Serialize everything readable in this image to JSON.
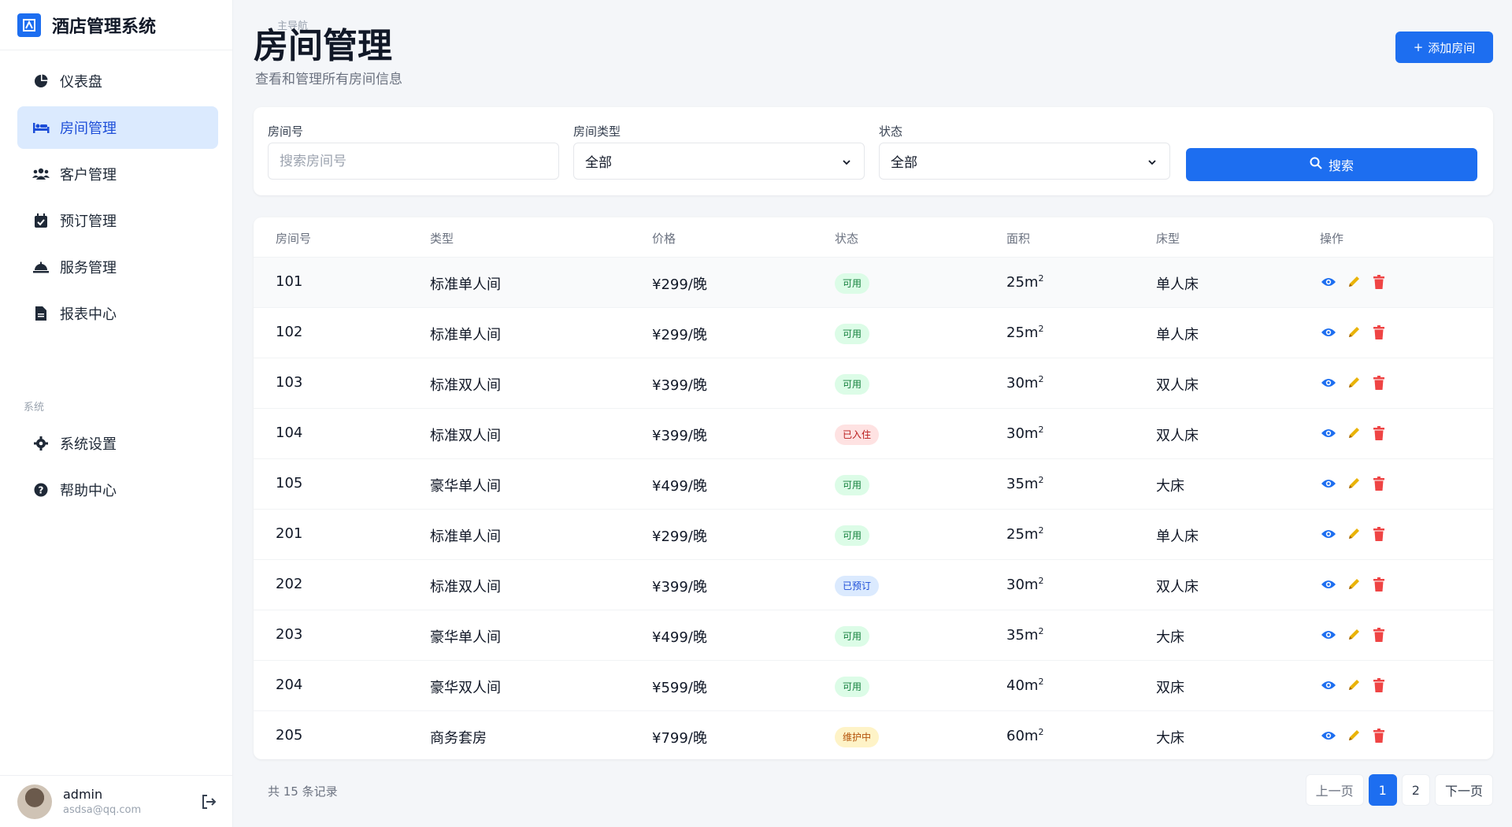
{
  "app": {
    "title": "酒店管理系统",
    "accent": "#1d6ef0"
  },
  "sidebar": {
    "section_main": "主导航",
    "section_system": "系统",
    "items": [
      {
        "label": "仪表盘",
        "icon": "chart-pie-icon"
      },
      {
        "label": "房间管理",
        "icon": "bed-icon",
        "active": true
      },
      {
        "label": "客户管理",
        "icon": "users-icon"
      },
      {
        "label": "预订管理",
        "icon": "calendar-check-icon"
      },
      {
        "label": "服务管理",
        "icon": "bell-concierge-icon"
      },
      {
        "label": "报表中心",
        "icon": "file-icon"
      }
    ],
    "system_items": [
      {
        "label": "系统设置",
        "icon": "gear-icon"
      },
      {
        "label": "帮助中心",
        "icon": "question-circle-icon"
      }
    ],
    "user": {
      "name": "admin",
      "email": "asdsa@qq.com"
    }
  },
  "header": {
    "title": "房间管理",
    "subtitle": "查看和管理所有房间信息",
    "add_button": "添加房间"
  },
  "filters": {
    "room_no_label": "房间号",
    "room_no_placeholder": "搜索房间号",
    "room_type_label": "房间类型",
    "room_type_value": "全部",
    "status_label": "状态",
    "status_value": "全部",
    "search_button": "搜索"
  },
  "table": {
    "columns": [
      "房间号",
      "类型",
      "价格",
      "状态",
      "面积",
      "床型",
      "操作"
    ],
    "rows": [
      {
        "no": "101",
        "type": "标准单人间",
        "price": "¥299/晚",
        "status": "可用",
        "status_color": "green",
        "area": "25m",
        "bed": "单人床"
      },
      {
        "no": "102",
        "type": "标准单人间",
        "price": "¥299/晚",
        "status": "可用",
        "status_color": "green",
        "area": "25m",
        "bed": "单人床"
      },
      {
        "no": "103",
        "type": "标准双人间",
        "price": "¥399/晚",
        "status": "可用",
        "status_color": "green",
        "area": "30m",
        "bed": "双人床"
      },
      {
        "no": "104",
        "type": "标准双人间",
        "price": "¥399/晚",
        "status": "已入住",
        "status_color": "red",
        "area": "30m",
        "bed": "双人床"
      },
      {
        "no": "105",
        "type": "豪华单人间",
        "price": "¥499/晚",
        "status": "可用",
        "status_color": "green",
        "area": "35m",
        "bed": "大床"
      },
      {
        "no": "201",
        "type": "标准单人间",
        "price": "¥299/晚",
        "status": "可用",
        "status_color": "green",
        "area": "25m",
        "bed": "单人床"
      },
      {
        "no": "202",
        "type": "标准双人间",
        "price": "¥399/晚",
        "status": "已预订",
        "status_color": "blue",
        "area": "30m",
        "bed": "双人床"
      },
      {
        "no": "203",
        "type": "豪华单人间",
        "price": "¥499/晚",
        "status": "可用",
        "status_color": "green",
        "area": "35m",
        "bed": "大床"
      },
      {
        "no": "204",
        "type": "豪华双人间",
        "price": "¥599/晚",
        "status": "可用",
        "status_color": "green",
        "area": "40m",
        "bed": "双床"
      },
      {
        "no": "205",
        "type": "商务套房",
        "price": "¥799/晚",
        "status": "维护中",
        "status_color": "yellow",
        "area": "60m",
        "bed": "大床"
      }
    ],
    "area_superscript": "2"
  },
  "pagination": {
    "total": "共 15 条记录",
    "prev": "上一页",
    "pages": [
      "1",
      "2"
    ],
    "current": "1",
    "next": "下一页"
  }
}
